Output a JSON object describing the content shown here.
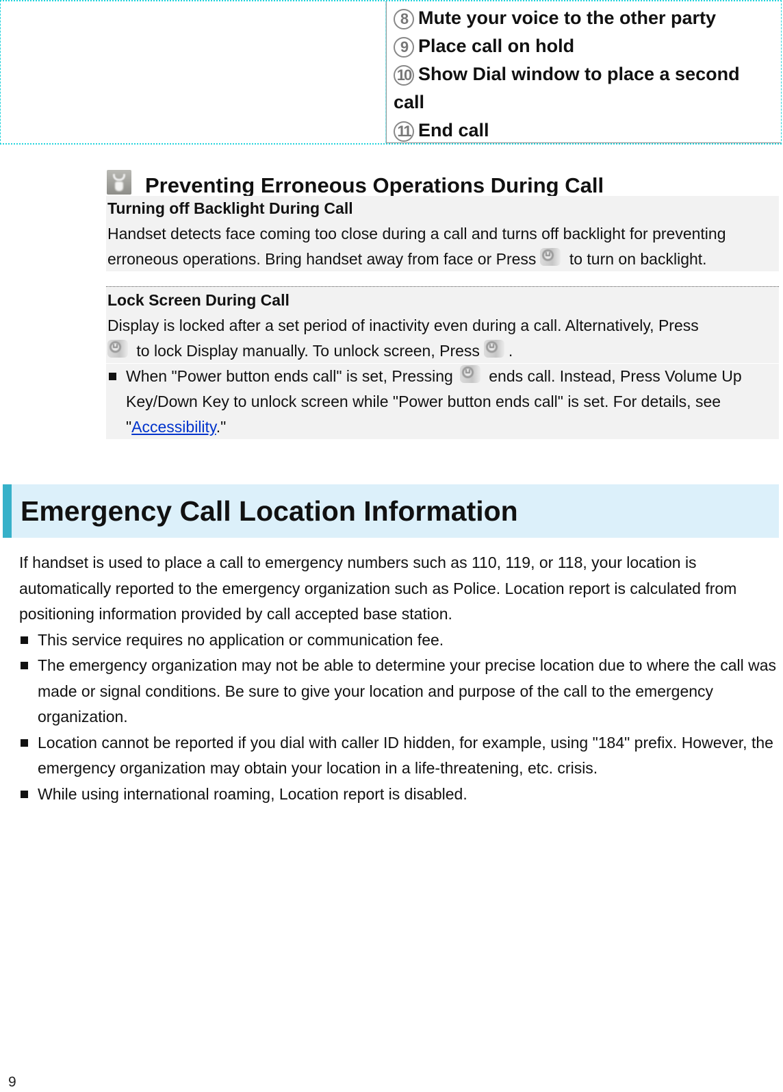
{
  "legend_table": {
    "items": [
      {
        "number": "8",
        "label": "Mute your voice to the other party"
      },
      {
        "number": "9",
        "label": "Place call on hold"
      },
      {
        "number": "10",
        "label": "Show Dial window to place a second call"
      },
      {
        "number": "11",
        "label": "End call"
      }
    ]
  },
  "tip": {
    "icon": "tip-hand-icon",
    "heading": "Preventing Erroneous Operations During Call",
    "notes": [
      {
        "title": "Turning off Backlight During Call",
        "text_before_icon": "Handset detects face coming too close during a call and turns off backlight for preventing erroneous operations. Bring handset away from face or Press",
        "icon": "power-key-icon",
        "text_after_icon": "to turn on backlight."
      },
      {
        "title": "Lock Screen During Call",
        "text_1": "Display is locked after a set period of inactivity even during a call. Alternatively, Press",
        "icon_1": "power-key-icon",
        "text_2": "to lock Display manually. To unlock screen, Press",
        "icon_2": "power-key-icon",
        "text_3": ".",
        "bullet": {
          "text_1": "When \"Power button ends call\" is set, Pressing",
          "icon": "power-key-icon",
          "text_2": "ends call. Instead, Press Volume Up Key/Down Key to unlock screen while \"Power button ends call\" is set. For details, see \"",
          "link": "Accessibility",
          "text_3": ".\""
        }
      }
    ]
  },
  "section": {
    "heading": "Emergency Call Location Information",
    "intro": "If handset is used to place a call to emergency numbers such as 110, 119, or 118, your location is automatically reported to the emergency organization such as Police. Location report is calculated from positioning information provided by call accepted base station.",
    "bullets": [
      "This service requires no application or communication fee.",
      "The emergency organization may not be able to determine your precise location due to where the call was made or signal conditions. Be sure to give your location and purpose of the call to the emergency organization.",
      "Location cannot be reported if you dial with caller ID hidden, for example, using \"184\" prefix. However, the emergency organization may obtain your location in a life-threatening, etc. crisis.",
      "While using international roaming, Location report is disabled."
    ]
  },
  "footer": {
    "page_number": "9"
  },
  "colors": {
    "table_border": "#22d3dc",
    "section_accent": "#37b1c9",
    "section_bg": "#dcf0fa",
    "note_bg": "#f2f2f2",
    "link": "#0033cc"
  }
}
